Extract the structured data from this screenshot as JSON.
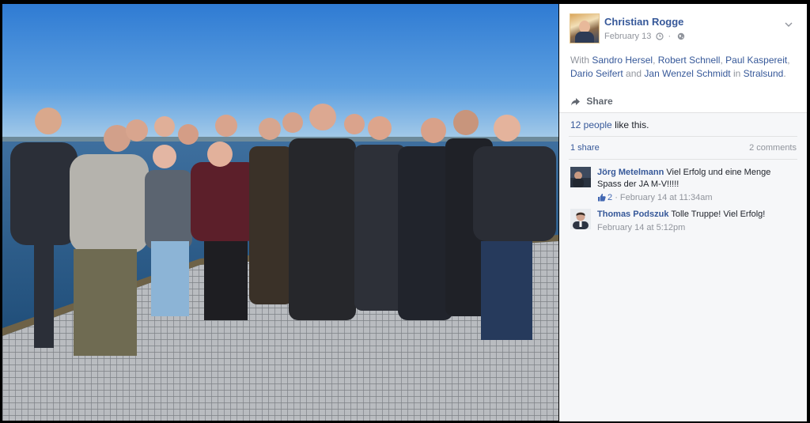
{
  "post": {
    "author": "Christian Rogge",
    "date": "February 13",
    "meta_separator": "·",
    "with_prefix": "With",
    "tagged": [
      "Sandro Hersel",
      "Robert Schnell",
      "Paul Kaspereit",
      "Dario Seifert",
      "Jan Wenzel Schmidt"
    ],
    "sep_comma": ",",
    "sep_and": "and",
    "in_word": "in",
    "location": "Stralsund",
    "period": "."
  },
  "actions": {
    "share_label": "Share"
  },
  "stats": {
    "likes_link": "12 people",
    "likes_suffix": "like this.",
    "shares": "1 share",
    "comments": "2 comments"
  },
  "comments": [
    {
      "author": "Jörg Metelmann",
      "text": "Viel Erfolg und eine Menge Spass der JA M-V!!!!!",
      "like_count": "2",
      "dot": "·",
      "time": "February 14 at 11:34am"
    },
    {
      "author": "Thomas Podszuk",
      "text": "Tolle Truppe! Viel Erfolg!",
      "time": "February 14 at 5:12pm"
    }
  ],
  "icons": {
    "clock": "clock-icon",
    "globe": "globe-icon",
    "chevron": "chevron-down-icon",
    "share": "share-arrow-icon",
    "like": "thumbs-up-icon"
  },
  "colors": {
    "link": "#365899",
    "muted": "#90949c",
    "sky": "#3d86d6",
    "panel_bg": "#f6f7f9"
  }
}
